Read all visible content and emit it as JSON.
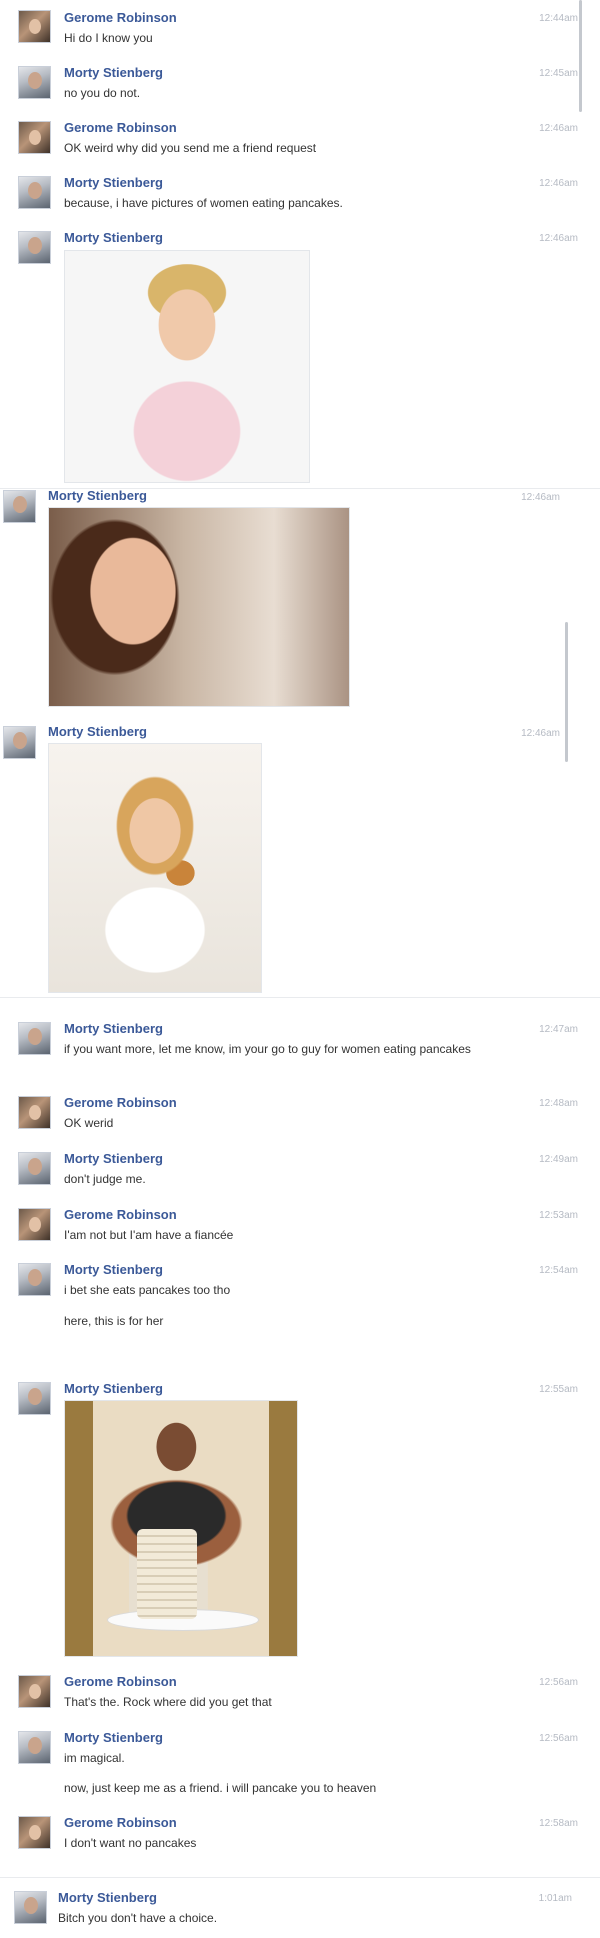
{
  "people": {
    "gerome": "Gerome Robinson",
    "morty": "Morty Stienberg"
  },
  "messages": [
    {
      "sender": "Gerome Robinson",
      "time": "12:44am",
      "text": "Hi do I know you"
    },
    {
      "sender": "Morty Stienberg",
      "time": "12:45am",
      "text": "no you do not."
    },
    {
      "sender": "Gerome Robinson",
      "time": "12:46am",
      "text": "OK weird why did you send me a friend request"
    },
    {
      "sender": "Morty Stienberg",
      "time": "12:46am",
      "text": "because, i have pictures of women eating pancakes."
    },
    {
      "sender": "Morty Stienberg",
      "time": "12:46am",
      "attachment": "photo-woman-pancakes-1"
    },
    {
      "sender": "Morty Stienberg",
      "time": "12:46am",
      "attachment": "photo-woman-pancakes-2"
    },
    {
      "sender": "Morty Stienberg",
      "time": "12:46am",
      "attachment": "photo-woman-pancakes-3"
    },
    {
      "sender": "Morty Stienberg",
      "time": "12:47am",
      "text": "if you want more, let me know, im your go to guy for women eating pancakes"
    },
    {
      "sender": "Gerome Robinson",
      "time": "12:48am",
      "text": "OK werid"
    },
    {
      "sender": "Morty Stienberg",
      "time": "12:49am",
      "text": "don't judge me."
    },
    {
      "sender": "Gerome Robinson",
      "time": "12:53am",
      "text": "I'am not but I'am have a fiancée"
    },
    {
      "sender": "Morty Stienberg",
      "time": "12:54am",
      "text": "i bet she eats pancakes too tho",
      "text2": "here, this is for her"
    },
    {
      "sender": "Morty Stienberg",
      "time": "12:55am",
      "attachment": "photo-man-pancake-stack"
    },
    {
      "sender": "Gerome Robinson",
      "time": "12:56am",
      "text": "That's the. Rock where did you get that"
    },
    {
      "sender": "Morty Stienberg",
      "time": "12:56am",
      "text": "im magical.",
      "text2": "now, just keep me as a friend. i will pancake you to heaven"
    },
    {
      "sender": "Gerome Robinson",
      "time": "12:58am",
      "text": "I don't want no pancakes"
    },
    {
      "sender": "Morty Stienberg",
      "time": "1:01am",
      "text": "Bitch you don't have a choice."
    }
  ]
}
